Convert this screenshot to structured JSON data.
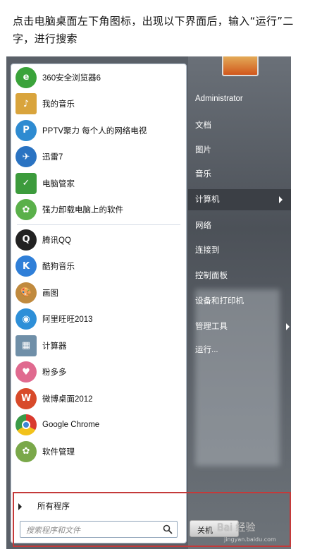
{
  "instruction": "点击电脑桌面左下角图标，出现以下界面后，输入“运行”二字，进行搜索",
  "start_menu": {
    "programs": [
      {
        "label": "360安全浏览器6",
        "icon": "360-browser-icon",
        "color": "#3aa33a"
      },
      {
        "label": "我的音乐",
        "icon": "music-folder-icon",
        "color": "#d9a43c"
      },
      {
        "label": "PPTV聚力 每个人的网络电视",
        "icon": "pptv-icon",
        "color": "#2e8bd1"
      },
      {
        "label": "迅雷7",
        "icon": "thunder-icon",
        "color": "#2a73c2"
      },
      {
        "label": "电脑管家",
        "icon": "tencent-pc-manager-icon",
        "color": "#3c9b3c"
      },
      {
        "label": "强力卸载电脑上的软件",
        "icon": "uninstall-icon",
        "color": "#5ab04a"
      },
      {
        "label": "腾讯QQ",
        "icon": "qq-icon",
        "color": "#222222"
      },
      {
        "label": "酷狗音乐",
        "icon": "kugou-icon",
        "color": "#2f7fd8"
      },
      {
        "label": "画图",
        "icon": "paint-icon",
        "color": "#c08a3e"
      },
      {
        "label": "阿里旺旺2013",
        "icon": "aliwangwang-icon",
        "color": "#2d8fd8"
      },
      {
        "label": "计算器",
        "icon": "calculator-icon",
        "color": "#6f8fa8"
      },
      {
        "label": "粉多多",
        "icon": "fenduoduo-icon",
        "color": "#e06a8f"
      },
      {
        "label": "微博桌面2012",
        "icon": "weibo-icon",
        "color": "#d84a2a"
      },
      {
        "label": "Google Chrome",
        "icon": "chrome-icon",
        "color": "#3b86d6"
      },
      {
        "label": "软件管理",
        "icon": "software-manager-icon",
        "color": "#7aa84a"
      }
    ],
    "all_programs": "所有程序",
    "search_placeholder": "搜索程序和文件",
    "right_items": [
      {
        "label": "Administrator"
      },
      {
        "label": "文档"
      },
      {
        "label": "图片"
      },
      {
        "label": "音乐"
      },
      {
        "label": "计算机"
      },
      {
        "label": "网络"
      },
      {
        "label": "连接到"
      },
      {
        "label": "控制面板"
      },
      {
        "label": "设备和打印机"
      },
      {
        "label": "管理工具"
      },
      {
        "label": "运行..."
      }
    ],
    "shutdown_label": "关机"
  },
  "watermark": {
    "brand": "Bai 经验",
    "url": "jingyan.baidu.com"
  },
  "colors": {
    "highlight_box": "#c43a3a",
    "menu_dark": "#3b3f45"
  }
}
